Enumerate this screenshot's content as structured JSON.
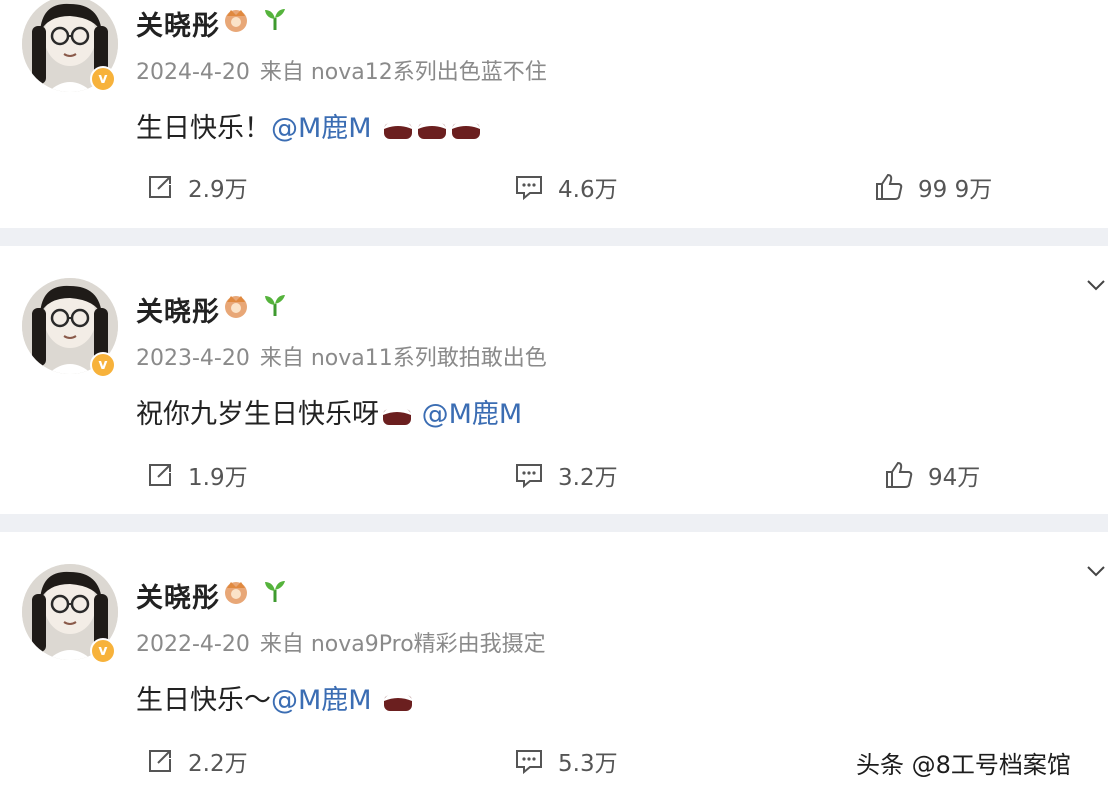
{
  "posts": [
    {
      "username": "关晓彤",
      "date": "2024-4-20",
      "source": "来自 nova12系列出色蓝不住",
      "text_before": "生日快乐！",
      "mention": "@M鹿M",
      "text_after": "",
      "repost_count": "2.9万",
      "comment_count": "4.6万",
      "like_count": "99 9万",
      "has_collapse_chevron": false
    },
    {
      "username": "关晓彤",
      "date": "2023-4-20",
      "source": "来自 nova11系列敢拍敢出色",
      "text_before": "祝你九岁生日快乐呀",
      "mention": "@M鹿M",
      "text_after": "",
      "repost_count": "1.9万",
      "comment_count": "3.2万",
      "like_count": "94万",
      "has_collapse_chevron": true
    },
    {
      "username": "关晓彤",
      "date": "2022-4-20",
      "source": "来自 nova9Pro精彩由我摄定",
      "text_before": "生日快乐～",
      "mention": "@M鹿M",
      "text_after": "",
      "repost_count": "2.2万",
      "comment_count": "5.3万",
      "like_count": "",
      "has_collapse_chevron": true
    }
  ],
  "watermark": "头条 @8工号档案馆",
  "icons": {
    "verified": "verified-v-badge",
    "member_badge": "crown-badge-icon",
    "sprout": "sprout-icon",
    "cake": "birthday-cake-emoji",
    "repost": "repost-icon",
    "comment": "comment-icon",
    "like": "thumbs-up-icon",
    "chevron": "chevron-down-icon"
  },
  "colors": {
    "username": "#222222",
    "meta": "#8a8a8a",
    "mention": "#3b6db3",
    "separator": "#eef0f4",
    "verified_badge": "#f7b23b"
  }
}
